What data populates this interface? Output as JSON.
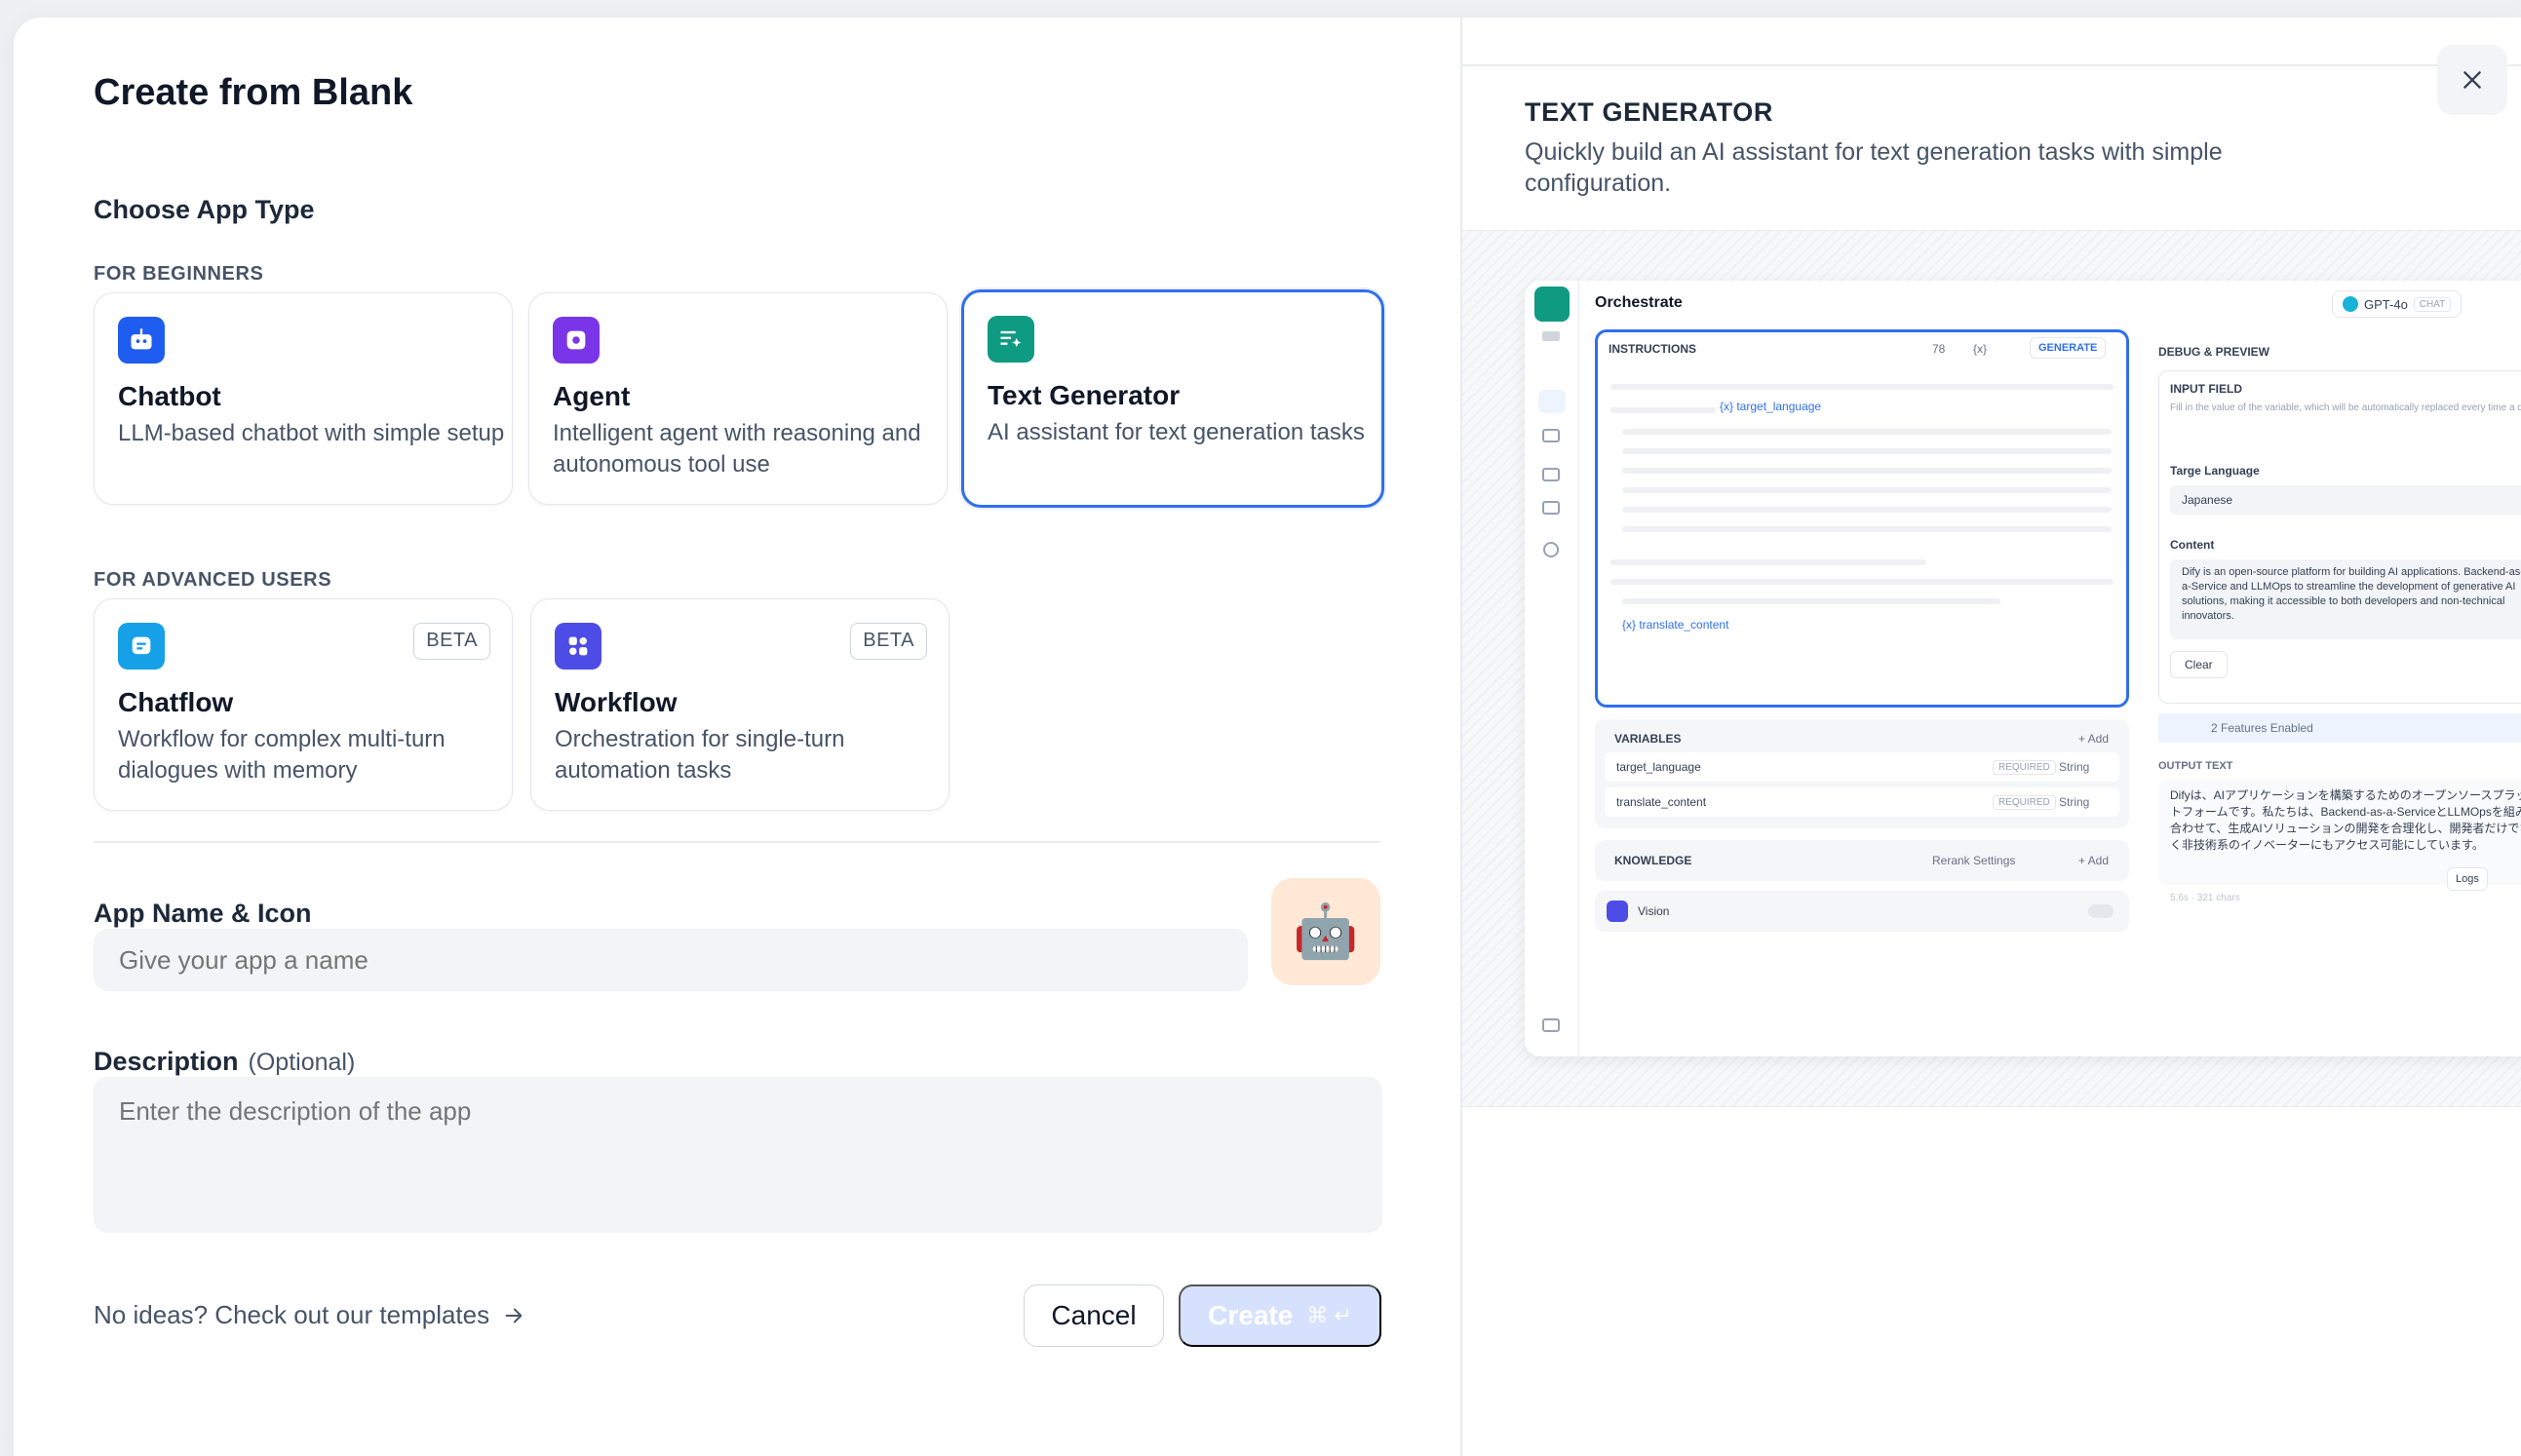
{
  "dialog": {
    "title": "Create from Blank",
    "choose_type": "Choose App Type",
    "for_beginners": "FOR BEGINNERS",
    "for_advanced": "FOR ADVANCED USERS",
    "cards": [
      {
        "title": "Chatbot",
        "desc": "LLM-based chatbot with simple setup",
        "icon": "chatbot-icon",
        "color": "#1f5cf0"
      },
      {
        "title": "Agent",
        "desc": "Intelligent agent with reasoning and autonomous tool use",
        "icon": "agent-icon",
        "color": "#7a35e8"
      },
      {
        "title": "Text Generator",
        "desc": "AI assistant for text generation tasks",
        "icon": "text-generator-icon",
        "color": "#0f9b82",
        "selected": true
      },
      {
        "title": "Chatflow",
        "desc": "Workflow for complex multi-turn dialogues with memory",
        "icon": "chatflow-icon",
        "color": "#16a0e8",
        "badge": "BETA"
      },
      {
        "title": "Workflow",
        "desc": "Orchestration for single-turn automation tasks",
        "icon": "workflow-icon",
        "color": "#4d4ce6",
        "badge": "BETA"
      }
    ],
    "name_label": "App Name & Icon",
    "name_placeholder": "Give your app a name",
    "app_icon_emoji": "🤖",
    "desc_label": "Description",
    "desc_optional": "(Optional)",
    "desc_placeholder": "Enter the description of the app",
    "templates_link": "No ideas? Check out our templates",
    "cancel": "Cancel",
    "create": "Create",
    "create_shortcut": "⌘ ↵"
  },
  "preview": {
    "title": "TEXT GENERATOR",
    "desc": "Quickly build an AI assistant for text generation tasks with simple configuration.",
    "mock": {
      "orchestrate": "Orchestrate",
      "model": "GPT-4o",
      "model_tag": "CHAT",
      "instructions": "INSTRUCTIONS",
      "count": "78",
      "var_symbol": "{x}",
      "generate": "GENERATE",
      "var1": "{x} target_language",
      "var2": "{x} translate_content",
      "variables": "VARIABLES",
      "add": "+ Add",
      "row1": "target_language",
      "row2": "translate_content",
      "required": "REQUIRED",
      "string": "String",
      "knowledge": "KNOWLEDGE",
      "rerank": "Rerank Settings",
      "vision": "Vision",
      "debug": "DEBUG & PREVIEW",
      "input_field": "INPUT FIELD",
      "input_hint": "Fill in the value of the variable, which will be automatically replaced every time a question is submitted.",
      "targe_language": "Targe Language",
      "japanese": "Japanese",
      "content": "Content",
      "content_text": "Dify is an open-source platform for building AI applications. Backend-as-a-Service and LLMOps to streamline the development of generative AI solutions, making it accessible to both developers and non-technical innovators.",
      "clear": "Clear",
      "features": "2 Features Enabled",
      "output_text": "OUTPUT TEXT",
      "output_body": "Difyは、AIアプリケーションを構築するためのオープンソースプラットフォームです。私たちは、Backend-as-a-ServiceとLLMOpsを組み合わせて、生成AIソリューションの開発を合理化し、開発者だけでなく非技術系のイノベーターにもアクセス可能にしています。",
      "logs": "Logs",
      "stats": "5.6s · 321 chars"
    }
  }
}
